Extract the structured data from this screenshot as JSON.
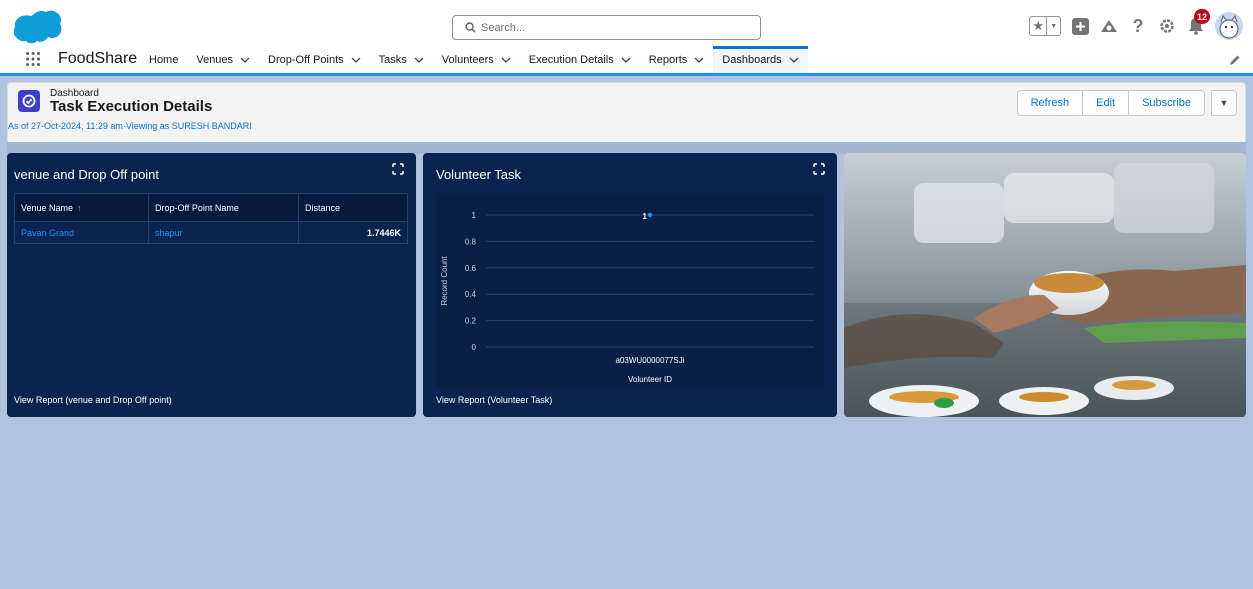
{
  "header": {
    "search_placeholder": "Search...",
    "notification_count": "12"
  },
  "nav": {
    "app_name": "FoodShare",
    "items": [
      {
        "label": "Home",
        "has_menu": false,
        "active": false
      },
      {
        "label": "Venues",
        "has_menu": true,
        "active": false
      },
      {
        "label": "Drop-Off Points",
        "has_menu": true,
        "active": false
      },
      {
        "label": "Tasks",
        "has_menu": true,
        "active": false
      },
      {
        "label": "Volunteers",
        "has_menu": true,
        "active": false
      },
      {
        "label": "Execution Details",
        "has_menu": true,
        "active": false
      },
      {
        "label": "Reports",
        "has_menu": true,
        "active": false
      },
      {
        "label": "Dashboards",
        "has_menu": true,
        "active": true
      }
    ]
  },
  "page": {
    "type_label": "Dashboard",
    "title": "Task Execution Details",
    "meta": "As of 27-Oct-2024, 11:29 am·Viewing as SURESH BANDARI",
    "buttons": {
      "refresh": "Refresh",
      "edit": "Edit",
      "subscribe": "Subscribe"
    }
  },
  "widgets": {
    "venue": {
      "title": "venue and Drop Off point",
      "columns": [
        "Venue Name",
        "Drop-Off Point Name",
        "Distance"
      ],
      "rows": [
        {
          "venue": "Pavan Grand",
          "drop_off": "shapur",
          "distance": "1.7446K"
        }
      ],
      "footer": "View Report (venue and Drop Off point)"
    },
    "volunteer": {
      "title": "Volunteer Task",
      "footer": "View Report (Volunteer Task)"
    },
    "image": {
      "description_icon": "food-serving-photo"
    }
  },
  "chart_data": {
    "type": "scatter",
    "categories": [
      "a03WU0000077SJi"
    ],
    "values": [
      1
    ],
    "data_labels": [
      "1"
    ],
    "xlabel": "Volunteer ID",
    "ylabel": "Record Count",
    "ylim": [
      0,
      1
    ],
    "yticks": [
      "0",
      "0.2",
      "0.4",
      "0.6",
      "0.8",
      "1"
    ],
    "grid": true,
    "color": "#1b96ff"
  },
  "colors": {
    "brand": "#0176d3",
    "widget_bg": "#0b2350",
    "canvas_bg": "#b0c4df",
    "badge": "#ba0517"
  }
}
